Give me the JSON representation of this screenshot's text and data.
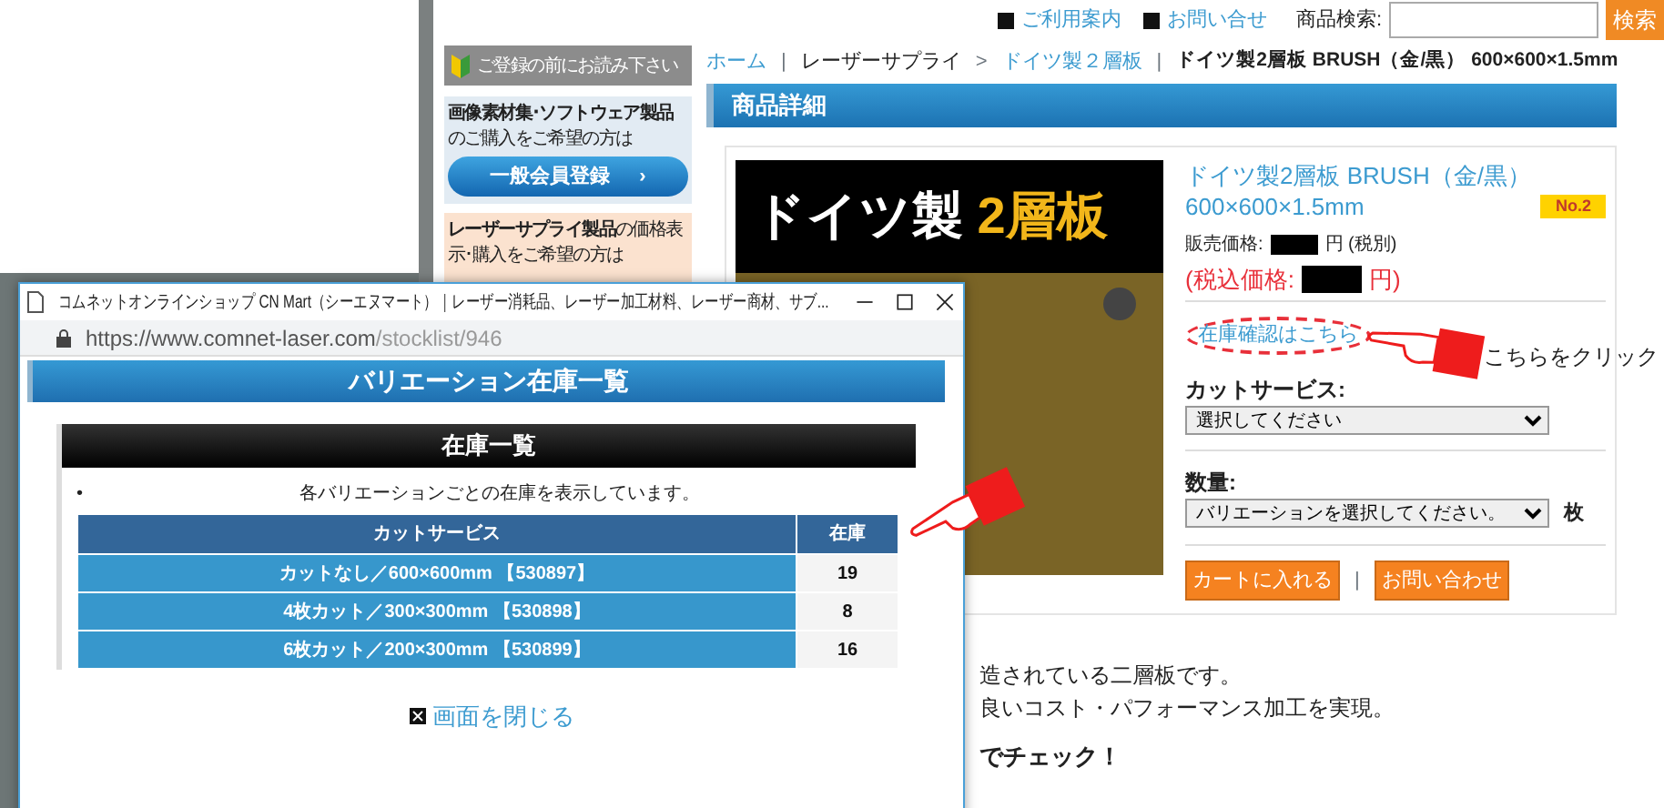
{
  "top_links": [
    {
      "label": "ご利用案内"
    },
    {
      "label": "お問い合せ"
    }
  ],
  "search": {
    "label": "商品検索:",
    "button": "検索"
  },
  "sidebar": {
    "notice": "ご登録の前にお読み下さい",
    "panels": [
      {
        "kind": "blue",
        "text": "**画像素材集･ソフトウェア製品**のご購入をご希望の方は",
        "button": "一般会員登録",
        "arrow": "›"
      },
      {
        "kind": "orange",
        "text": "**レーザーサプライ製品**の価格表示･購入をご希望の方は"
      }
    ]
  },
  "breadcrumb": [
    {
      "label": "ホーム",
      "link": true,
      "sep": "|"
    },
    {
      "label": "レーザーサプライ",
      "link": false,
      "sep": ">"
    },
    {
      "label": "ドイツ製２層板",
      "link": true,
      "sep": "|"
    },
    {
      "label": "ドイツ製2層板 BRUSH（金/黒） 600×600×1.5mm",
      "link": false
    }
  ],
  "section_title": "商品詳細",
  "product": {
    "banner": [
      "ドイツ製",
      "2層板"
    ],
    "name": "ドイツ製2層板 BRUSH（金/黒） 600×600×1.5mm",
    "badge": "No.2",
    "price_label": "販売価格:",
    "price_suffix": "円 (税別)",
    "tax_label": "(税込価格:",
    "tax_suffix": "円)",
    "stock_link": "在庫確認はこちら",
    "callout": "こちらをクリック",
    "options": [
      {
        "label": "カットサービス:",
        "value": "選択してください"
      },
      {
        "label": "数量:",
        "value": "バリエーションを選択してください。",
        "unit": "枚"
      }
    ],
    "buttons": [
      "カートに入れる",
      "お問い合わせ"
    ],
    "button_separator": "|"
  },
  "description": [
    "造されている二層板です。",
    "良いコスト・パフォーマンス加工を実現。"
  ],
  "check_heading": "でチェック！",
  "popup": {
    "title": "コムネットオンラインショップ CN Mart（シーエヌマート）｜レーザー消耗品、レーザー加工材料、レーザー商材、サブ...",
    "url_host": "https://www.comnet-laser.com",
    "url_path": "/stocklist/946",
    "heading": "バリエーション在庫一覧",
    "subheading": "在庫一覧",
    "bullet": "•",
    "note": "各バリエーションごとの在庫を表示しています。",
    "columns": [
      "カットサービス",
      "在庫"
    ],
    "rows": [
      [
        "カットなし／600×600mm 【530897】",
        "19"
      ],
      [
        "4枚カット／300×300mm 【530898】",
        "8"
      ],
      [
        "6枚カット／200×300mm 【530899】",
        "16"
      ]
    ],
    "close": "画面を閉じる"
  }
}
